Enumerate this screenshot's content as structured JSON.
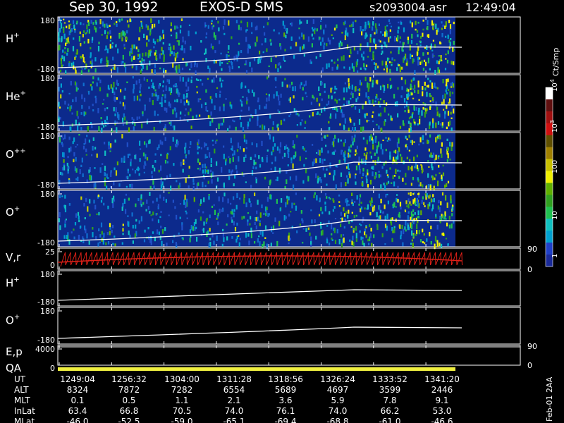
{
  "header": {
    "date": "Sep 30, 1992",
    "mission": "EXOS-D SMS",
    "file": "s2093004.asr",
    "time": "12:49:04"
  },
  "colors": {
    "background": "#000000",
    "panel_fill": "#0c2a8c",
    "trace": "#ffffff",
    "vr_trace": "#e02018",
    "qa_bar": "#f0f040"
  },
  "colorbar": {
    "unit": "Ct/Smp",
    "ticks": [
      "1",
      "10",
      "100",
      "10",
      "10"
    ],
    "tick_exponents": [
      "",
      "",
      "",
      "3",
      "4"
    ],
    "colors": [
      "#1a2a9a",
      "#2040c8",
      "#00a0d0",
      "#10c0c0",
      "#20c050",
      "#30a020",
      "#60b000",
      "#f0f000",
      "#c8c000",
      "#a08000",
      "#605000",
      "#d01010",
      "#a01010",
      "#601010",
      "#ffffff"
    ]
  },
  "footer_note": "Feb-01 2AA",
  "chart_data": {
    "type": "heatmap",
    "panels": [
      {
        "species": "H",
        "charge": "+",
        "ytop": "180",
        "ybot": "-180"
      },
      {
        "species": "He",
        "charge": "+",
        "ytop": "180",
        "ybot": "-180"
      },
      {
        "species": "O",
        "charge": "++",
        "ytop": "180",
        "ybot": "-180"
      },
      {
        "species": "O",
        "charge": "+",
        "ytop": "180",
        "ybot": "-180"
      },
      {
        "species": "V,r",
        "charge": "",
        "ytop": "25",
        "ybot": "0",
        "right_top": "90",
        "right_bot": "0"
      },
      {
        "species": "H",
        "charge": "+",
        "ytop": "180",
        "ybot": "-180"
      },
      {
        "species": "O",
        "charge": "+",
        "ytop": "180",
        "ybot": "-180"
      },
      {
        "species": "E,p",
        "charge": "",
        "ytop": "4000",
        "ybot": "",
        "right_top": "90",
        "right_bot": "0"
      },
      {
        "species": "QA",
        "charge": "",
        "ytop": "",
        "ybot": "0"
      }
    ],
    "time_axis": {
      "rows": [
        {
          "label": "UT",
          "values": [
            "1249:04",
            "1256:32",
            "1304:00",
            "1311:28",
            "1318:56",
            "1326:24",
            "1333:52",
            "1341:20"
          ]
        },
        {
          "label": "ALT",
          "values": [
            "8324",
            "7872",
            "7282",
            "6554",
            "5689",
            "4697",
            "3599",
            "2446"
          ]
        },
        {
          "label": "MLT",
          "values": [
            "0.1",
            "0.5",
            "1.1",
            "2.1",
            "3.6",
            "5.9",
            "7.8",
            "9.1"
          ]
        },
        {
          "label": "InLat",
          "values": [
            "63.4",
            "66.8",
            "70.5",
            "74.0",
            "76.1",
            "74.0",
            "66.2",
            "53.0"
          ]
        },
        {
          "label": "MLat",
          "values": [
            "-46.0",
            "-52.5",
            "-59.0",
            "-65.1",
            "-69.4",
            "-68.8",
            "-61.0",
            "-46.6"
          ]
        }
      ]
    }
  }
}
